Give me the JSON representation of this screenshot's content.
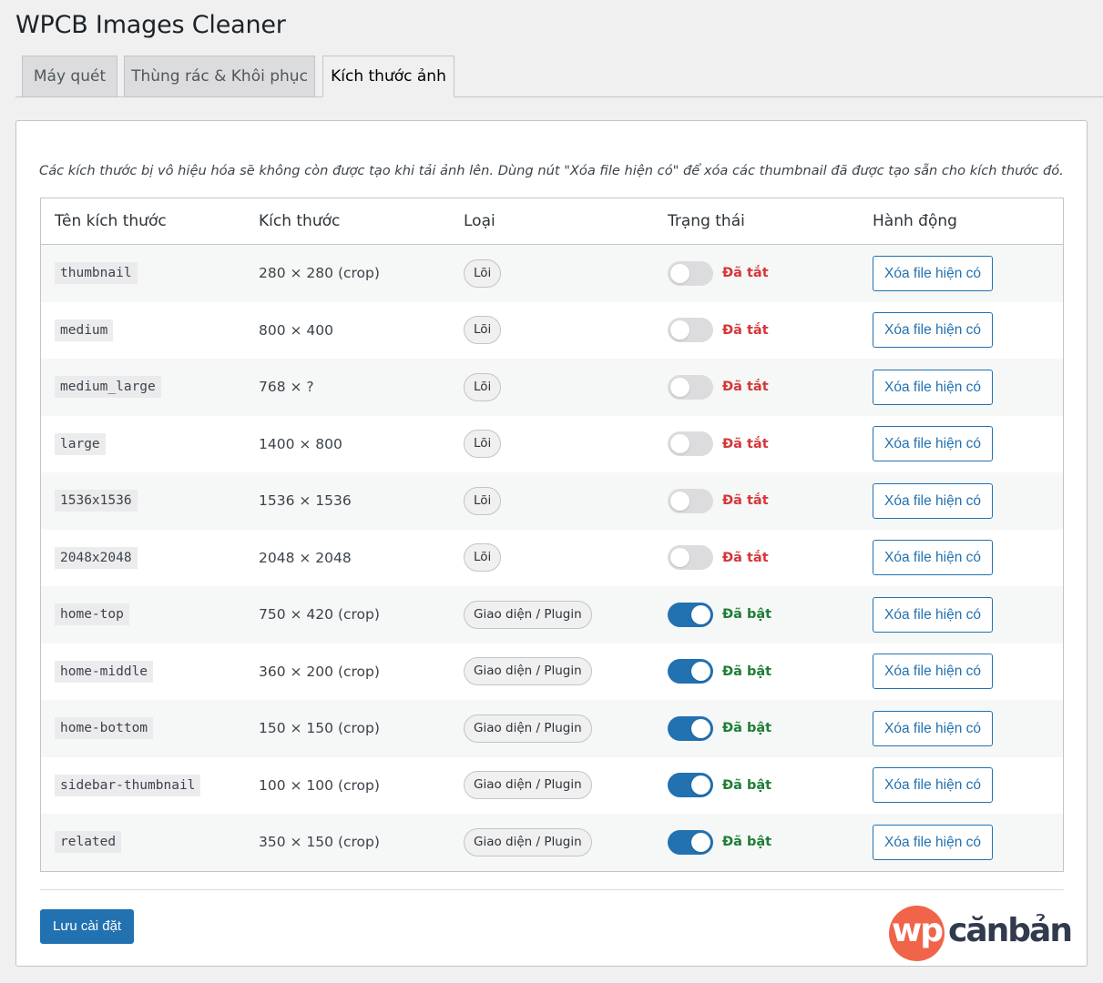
{
  "page": {
    "title": "WPCB Images Cleaner"
  },
  "tabs": [
    {
      "label": "Máy quét",
      "active": false
    },
    {
      "label": "Thùng rác & Khôi phục",
      "active": false
    },
    {
      "label": "Kích thước ảnh",
      "active": true
    }
  ],
  "description": "Các kích thước bị vô hiệu hóa sẽ không còn được tạo khi tải ảnh lên. Dùng nút \"Xóa file hiện có\" để xóa các thumbnail đã được tạo sẵn cho kích thước đó.",
  "table": {
    "headers": [
      "Tên kích thước",
      "Kích thước",
      "Loại",
      "Trạng thái",
      "Hành động"
    ],
    "rows": [
      {
        "name": "thumbnail",
        "dimension": "280 × 280 (crop)",
        "type": "Lõi",
        "enabled": false,
        "status": "Đã tắt",
        "action": "Xóa file hiện có"
      },
      {
        "name": "medium",
        "dimension": "800 × 400",
        "type": "Lõi",
        "enabled": false,
        "status": "Đã tắt",
        "action": "Xóa file hiện có"
      },
      {
        "name": "medium_large",
        "dimension": "768 × ?",
        "type": "Lõi",
        "enabled": false,
        "status": "Đã tắt",
        "action": "Xóa file hiện có"
      },
      {
        "name": "large",
        "dimension": "1400 × 800",
        "type": "Lõi",
        "enabled": false,
        "status": "Đã tắt",
        "action": "Xóa file hiện có"
      },
      {
        "name": "1536x1536",
        "dimension": "1536 × 1536",
        "type": "Lõi",
        "enabled": false,
        "status": "Đã tắt",
        "action": "Xóa file hiện có"
      },
      {
        "name": "2048x2048",
        "dimension": "2048 × 2048",
        "type": "Lõi",
        "enabled": false,
        "status": "Đã tắt",
        "action": "Xóa file hiện có"
      },
      {
        "name": "home-top",
        "dimension": "750 × 420 (crop)",
        "type": "Giao diện / Plugin",
        "enabled": true,
        "status": "Đã bật",
        "action": "Xóa file hiện có"
      },
      {
        "name": "home-middle",
        "dimension": "360 × 200 (crop)",
        "type": "Giao diện / Plugin",
        "enabled": true,
        "status": "Đã bật",
        "action": "Xóa file hiện có"
      },
      {
        "name": "home-bottom",
        "dimension": "150 × 150 (crop)",
        "type": "Giao diện / Plugin",
        "enabled": true,
        "status": "Đã bật",
        "action": "Xóa file hiện có"
      },
      {
        "name": "sidebar-thumbnail",
        "dimension": "100 × 100 (crop)",
        "type": "Giao diện / Plugin",
        "enabled": true,
        "status": "Đã bật",
        "action": "Xóa file hiện có"
      },
      {
        "name": "related",
        "dimension": "350 × 150 (crop)",
        "type": "Giao diện / Plugin",
        "enabled": true,
        "status": "Đã bật",
        "action": "Xóa file hiện có"
      }
    ]
  },
  "footer": {
    "save_label": "Lưu cài đặt"
  },
  "logo": {
    "wp": "wp",
    "text": "cănbản"
  },
  "colors": {
    "accent": "#2271b1",
    "status_off": "#d63638",
    "status_on": "#1e7e34",
    "logo_circle": "#f06449",
    "logo_text": "#323a4e"
  }
}
